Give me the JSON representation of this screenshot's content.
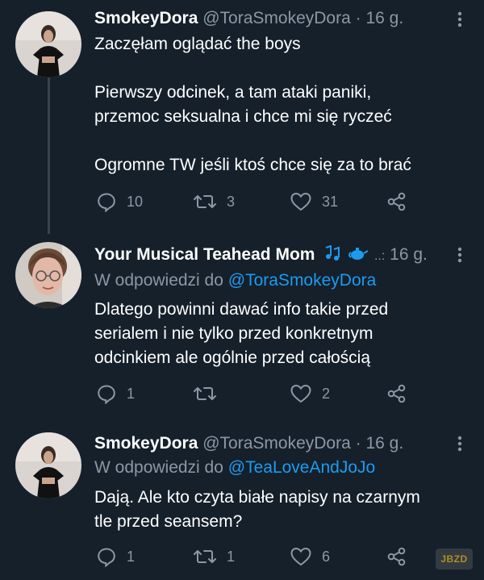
{
  "tweets": [
    {
      "author": "SmokeyDora",
      "handle": "@ToraSmokeyDora",
      "dot": "·",
      "time": "16 g.",
      "text_lines": [
        "Zaczęłam oglądać the boys",
        "",
        "Pierwszy odcinek, a tam ataki paniki,",
        "przemoc seksualna i chce mi się ryczeć",
        "",
        "Ogromne TW jeśli ktoś chce się za to brać"
      ],
      "replies": "10",
      "retweets": "3",
      "likes": "31"
    },
    {
      "author": "Your Musical Teahead Mom",
      "handle_suffix": "..:",
      "time": "16 g.",
      "reply_prefix": "W odpowiedzi do",
      "reply_to": "@ToraSmokeyDora",
      "text_lines": [
        "Dlatego powinni dawać info takie przed",
        "serialem i nie tylko przed konkretnym",
        "odcinkiem ale ogólnie przed całością"
      ],
      "replies": "1",
      "retweets": "",
      "likes": "2"
    },
    {
      "author": "SmokeyDora",
      "handle": "@ToraSmokeyDora",
      "dot": "·",
      "time": "16 g.",
      "reply_prefix": "W odpowiedzi do",
      "reply_to": "@TeaLoveAndJoJo",
      "text_lines": [
        "Dają. Ale kto czyta białe napisy na czarnym",
        "tle przed seansem?"
      ],
      "replies": "1",
      "retweets": "1",
      "likes": "6"
    }
  ],
  "watermark": "JBZD",
  "icons": {
    "reply": "reply-icon",
    "retweet": "retweet-icon",
    "like": "heart-icon",
    "share": "share-icon",
    "more": "more-icon"
  },
  "colors": {
    "background": "#15202b",
    "text": "#ffffff",
    "secondary": "#8b98a5",
    "link": "#1d9bf0",
    "thread_line": "#38444d"
  }
}
